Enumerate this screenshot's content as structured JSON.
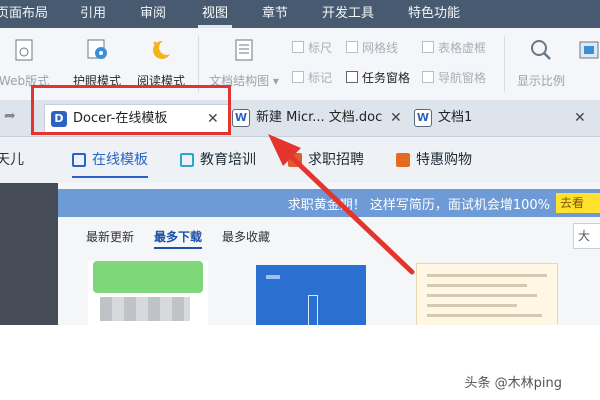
{
  "menu": {
    "items": [
      "页面布局",
      "引用",
      "审阅",
      "视图",
      "章节",
      "开发工具",
      "特色功能"
    ],
    "active_index": 3
  },
  "ribbon": {
    "buttons": [
      "Web版式",
      "护眼模式",
      "阅读模式",
      "文档结构图",
      "显示比例"
    ],
    "checks": [
      {
        "label": "标尺",
        "checked": false,
        "enabled": false
      },
      {
        "label": "网格线",
        "checked": false,
        "enabled": false
      },
      {
        "label": "表格虚框",
        "checked": false,
        "enabled": false
      },
      {
        "label": "标记",
        "checked": false,
        "enabled": false
      },
      {
        "label": "任务窗格",
        "checked": false,
        "enabled": true
      },
      {
        "label": "导航窗格",
        "checked": false,
        "enabled": false
      }
    ]
  },
  "tabs": [
    {
      "label": "Docer-在线模板",
      "icon": "docer-logo-icon",
      "active": true,
      "close": "✕"
    },
    {
      "label": "新建 Micr... 文档.doc",
      "icon": "document-icon",
      "active": false,
      "close": "✕"
    },
    {
      "label": "文档1",
      "icon": "document-icon",
      "active": false,
      "close": "✕"
    }
  ],
  "categories": [
    {
      "label": "在线模板",
      "color": "#2a63c6",
      "active": true
    },
    {
      "label": "教育培训",
      "color": "#2aa7c9",
      "active": false
    },
    {
      "label": "求职招聘",
      "color": "#e25b2f",
      "active": false
    },
    {
      "label": "特惠购物",
      "color": "#e36a1e",
      "active": false
    }
  ],
  "sidebar": {
    "partial_text": "天儿"
  },
  "banner": {
    "text": "求职黄金期！ 这样写简历，面试机会增100%",
    "button": "去看"
  },
  "sort_tabs": [
    "最新更新",
    "最多下载",
    "最多收藏"
  ],
  "sort_active": 1,
  "search": {
    "partial_text": "大"
  },
  "watermark": "头条 @木林ping",
  "colors": {
    "highlight": "#e4342e",
    "menubar": "#485a70"
  }
}
